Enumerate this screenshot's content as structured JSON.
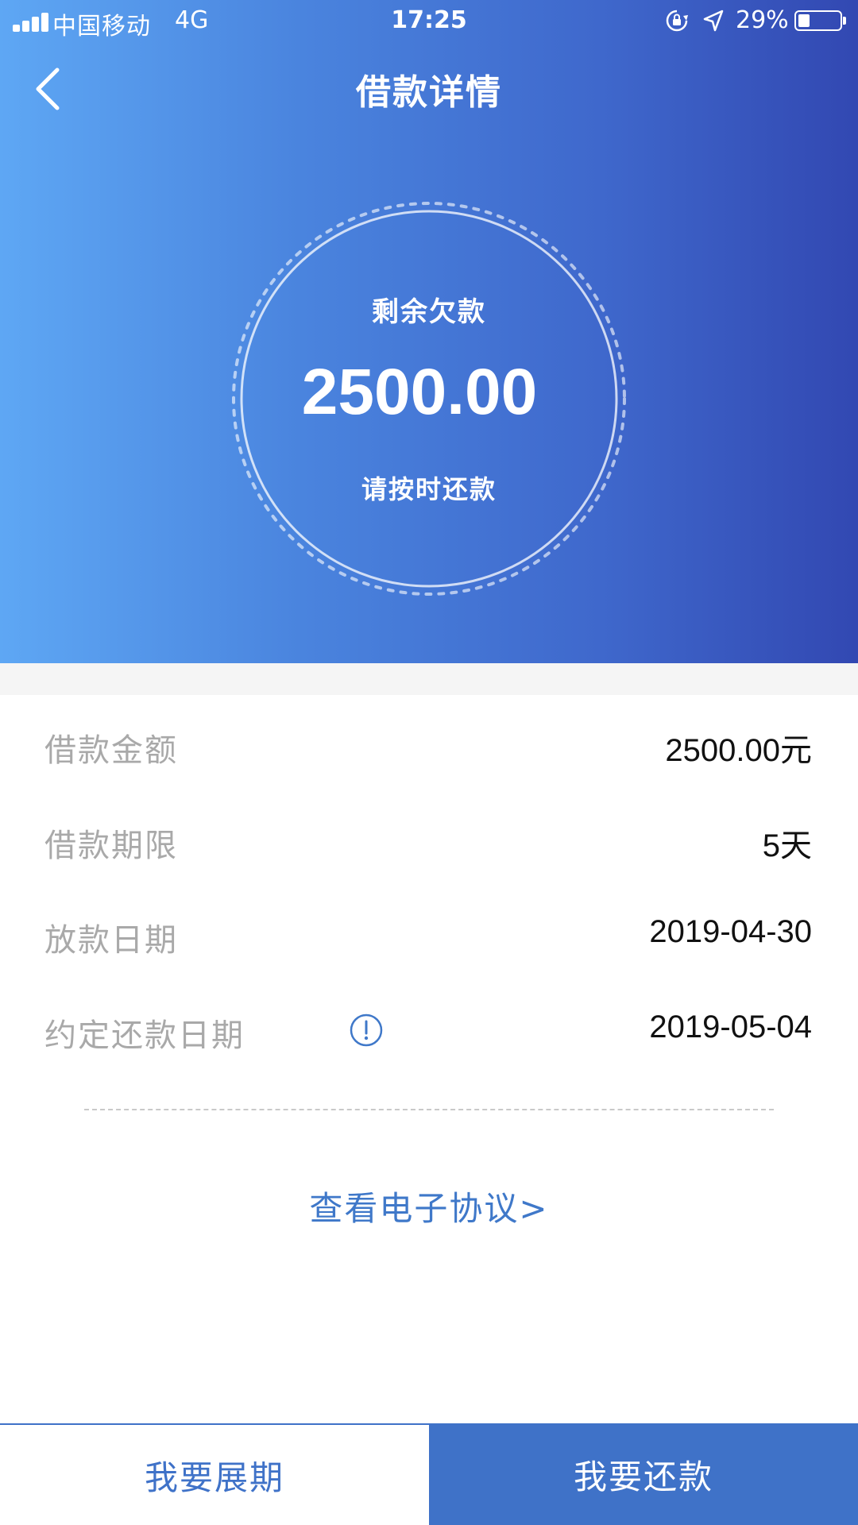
{
  "status_bar": {
    "carrier": "中国移动",
    "network": "4G",
    "time": "17:25",
    "battery_percent": "29%",
    "icons": [
      "signal-icon",
      "orientation-lock-icon",
      "location-arrow-icon",
      "battery-icon"
    ]
  },
  "nav": {
    "back_icon": "chevron-left-icon",
    "title": "借款详情"
  },
  "summary": {
    "label": "剩余欠款",
    "amount": "2500.00",
    "hint": "请按时还款"
  },
  "details": [
    {
      "label": "借款金额",
      "value": "2500.00元"
    },
    {
      "label": "借款期限",
      "value": "5天"
    },
    {
      "label": "放款日期",
      "value": "2019-04-30"
    },
    {
      "label": "约定还款日期",
      "value": "2019-05-04",
      "icon": "info-icon"
    }
  ],
  "agreement_link": "查看电子协议>",
  "bottom_buttons": {
    "extend": "我要展期",
    "repay": "我要还款"
  },
  "colors": {
    "hero_gradient_start": "#5ea7f4",
    "hero_gradient_end": "#3248b2",
    "accent": "#3f72c8",
    "label_gray": "#a9a9a9"
  }
}
